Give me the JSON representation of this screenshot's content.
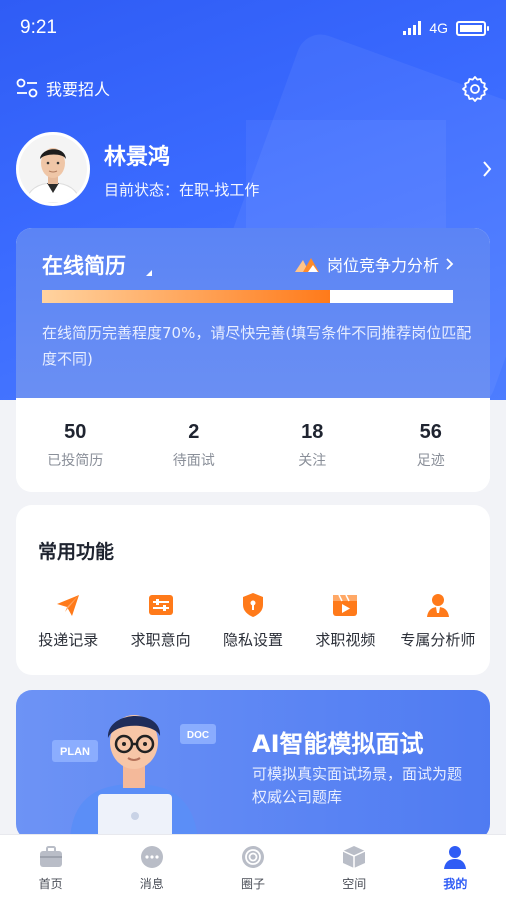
{
  "status_bar": {
    "time": "9:21",
    "network": "4G"
  },
  "header": {
    "recruit_label": "我要招人"
  },
  "profile": {
    "name": "林景鸿",
    "status": "目前状态：在职-找工作"
  },
  "resume": {
    "title": "在线简历",
    "competition_label": "岗位竞争力分析",
    "progress_percent": 70,
    "hint": "在线简历完善程度70%，请尽快完善(填写条件不同推荐岗位匹配度不同)"
  },
  "stats": [
    {
      "value": "50",
      "label": "已投简历"
    },
    {
      "value": "2",
      "label": "待面试"
    },
    {
      "value": "18",
      "label": "关注"
    },
    {
      "value": "56",
      "label": "足迹"
    }
  ],
  "functions": {
    "title": "常用功能",
    "items": [
      {
        "label": "投递记录",
        "icon": "send-icon"
      },
      {
        "label": "求职意向",
        "icon": "intent-icon"
      },
      {
        "label": "隐私设置",
        "icon": "shield-icon"
      },
      {
        "label": "求职视频",
        "icon": "video-icon"
      },
      {
        "label": "专属分析师",
        "icon": "analyst-icon"
      }
    ]
  },
  "ai": {
    "title": "AI智能模拟面试",
    "desc": "可模拟真实面试场景，面试为题权威公司题库",
    "tag_plan": "PLAN",
    "tag_doc": "DOC"
  },
  "tabs": [
    {
      "label": "首页",
      "icon": "briefcase-icon"
    },
    {
      "label": "消息",
      "icon": "message-icon"
    },
    {
      "label": "圈子",
      "icon": "circle-icon"
    },
    {
      "label": "空间",
      "icon": "cube-icon"
    },
    {
      "label": "我的",
      "icon": "person-icon",
      "active": true
    }
  ],
  "colors": {
    "primary": "#2f5cf5",
    "accent": "#ff7a1a"
  }
}
